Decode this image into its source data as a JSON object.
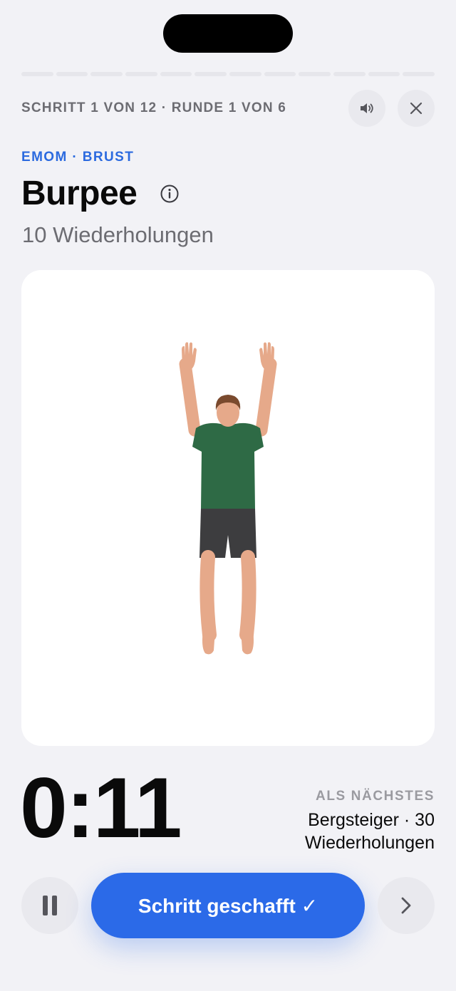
{
  "progress": {
    "total_steps": 12,
    "completed_steps": 0
  },
  "header": {
    "step_text": "SCHRITT 1 VON 12 · RUNDE 1 VON 6"
  },
  "exercise": {
    "category": "EMOM · BRUST",
    "name": "Burpee",
    "reps": "10 Wiederholungen"
  },
  "timer": {
    "value": "0:11"
  },
  "next": {
    "label": "ALS NÄCHSTES",
    "value": "Bergsteiger · 30 Wiederholungen"
  },
  "controls": {
    "done_label": "Schritt geschafft ✓"
  },
  "icons": {
    "sound": "speaker-icon",
    "close": "close-icon",
    "info": "info-icon",
    "pause": "pause-icon",
    "skip": "chevron-right-icon"
  },
  "colors": {
    "accent": "#2b6ae8",
    "category": "#2b6adf",
    "background": "#f2f2f6",
    "shirt": "#2e6a45",
    "shorts": "#3d3d3f",
    "skin": "#e6a98a"
  }
}
